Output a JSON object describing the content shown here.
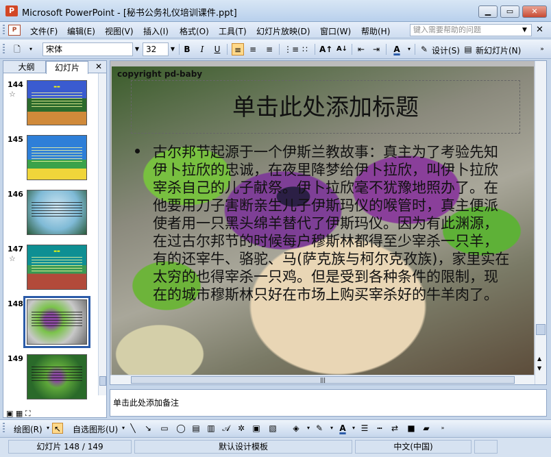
{
  "window": {
    "title": "Microsoft PowerPoint - [秘书公务礼仪培训课件.ppt]",
    "app_icon": "P"
  },
  "menu": {
    "items": [
      "文件(F)",
      "编辑(E)",
      "视图(V)",
      "插入(I)",
      "格式(O)",
      "工具(T)",
      "幻灯片放映(D)",
      "窗口(W)",
      "帮助(H)"
    ],
    "help_placeholder": "键入需要帮助的问题"
  },
  "format_toolbar": {
    "font_name": "宋体",
    "font_size": "32",
    "bold": "B",
    "italic": "I",
    "underline": "U",
    "design_label": "设计(S)",
    "new_slide_label": "新幻灯片(N)"
  },
  "left_pane": {
    "tab_outline": "大纲",
    "tab_slides": "幻灯片",
    "slides": [
      {
        "number": "144",
        "has_star": true
      },
      {
        "number": "145",
        "has_star": false
      },
      {
        "number": "146",
        "has_star": false
      },
      {
        "number": "147",
        "has_star": true
      },
      {
        "number": "148",
        "has_star": false,
        "selected": true
      },
      {
        "number": "149",
        "has_star": false
      }
    ],
    "star_glyph": "☆"
  },
  "slide": {
    "copyright": "copyright pd-baby",
    "title_placeholder": "单击此处添加标题",
    "body": "古尔邦节起源于一个伊斯兰教故事：真主为了考验先知伊卜拉欣的忠诚，在夜里降梦给伊卜拉欣，叫伊卜拉欣宰杀自己的儿子献祭。伊卜拉欣毫不犹豫地照办了。在他要用刀子害断亲生儿子伊斯玛仪的喉管时，真主便派使者用一只黑头绵羊替代了伊斯玛仪。因为有此渊源，在过古尔邦节的时候每户穆斯林都得至少宰杀一只羊，有的还宰牛、骆驼、马(萨克族与柯尔克孜族)，家里实在太穷的也得宰杀一只鸡。但是受到各种条件的限制，现在的城市穆斯林只好在市场上购买宰杀好的牛羊肉了。"
  },
  "notes": {
    "placeholder": "单击此处添加备注"
  },
  "drawing_toolbar": {
    "draw_label": "绘图(R)",
    "autoshape_label": "自选图形(U)"
  },
  "status": {
    "slide_pos": "幻灯片 148 / 149",
    "template": "默认设计模板",
    "language": "中文(中国)"
  },
  "colors": {
    "accent": "#2b5ba8",
    "chrome": "#c6d6ea",
    "close": "#c74a32"
  }
}
